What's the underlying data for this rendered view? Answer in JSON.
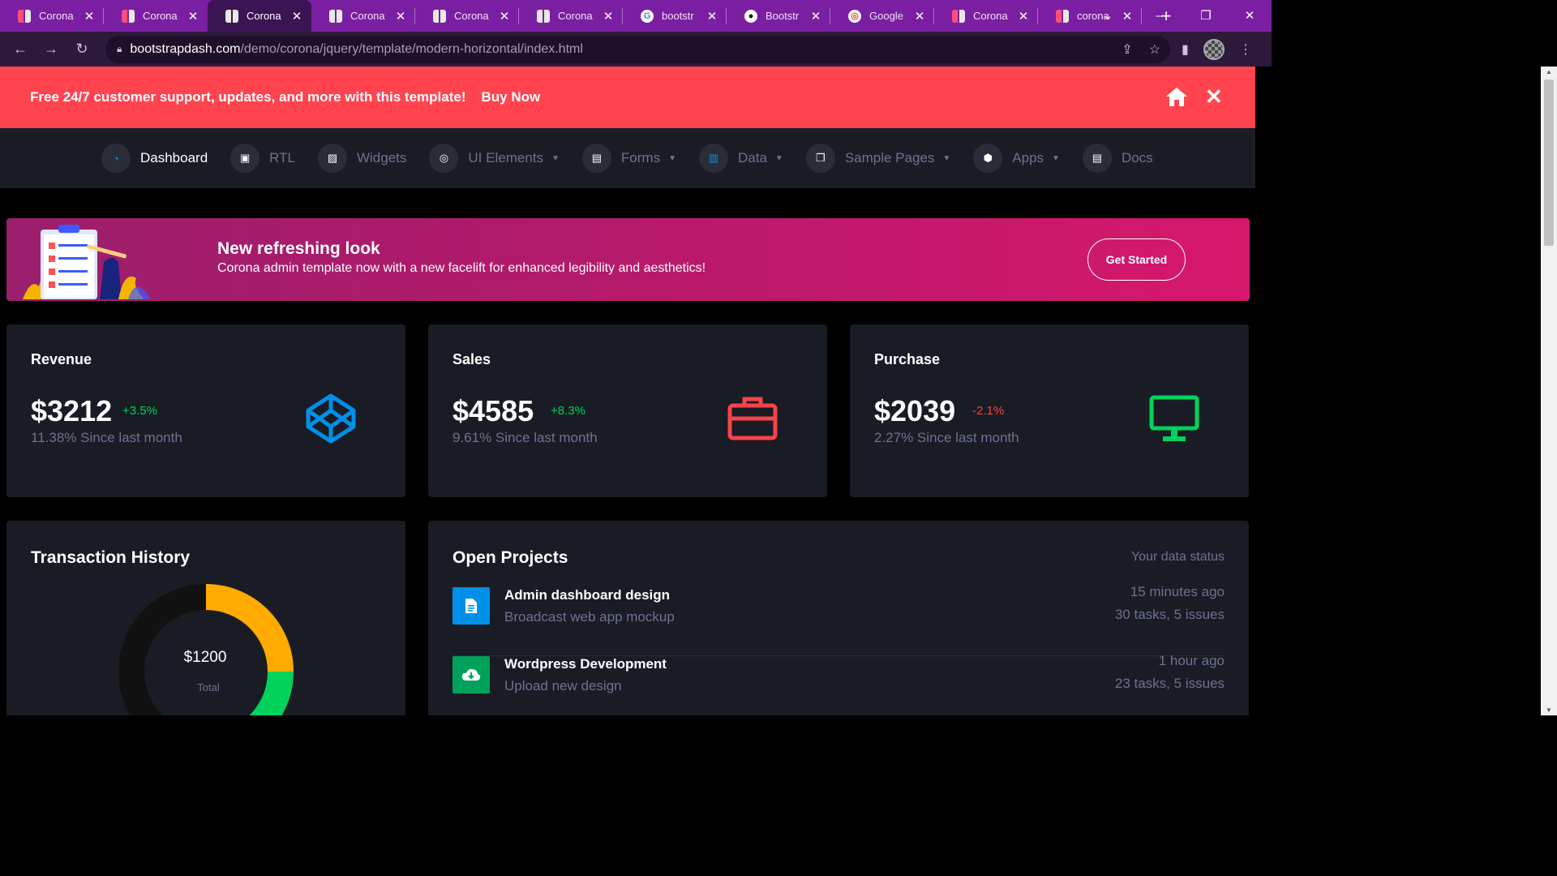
{
  "browser": {
    "tabs": [
      {
        "title": "Corona",
        "icon": "corona-favicon",
        "active": false
      },
      {
        "title": "Corona",
        "icon": "corona-favicon",
        "active": false
      },
      {
        "title": "Corona",
        "icon": "corona-favicon",
        "active": true
      },
      {
        "title": "Corona",
        "icon": "corona-favicon",
        "active": false
      },
      {
        "title": "Corona",
        "icon": "corona-favicon",
        "active": false
      },
      {
        "title": "Corona",
        "icon": "corona-favicon",
        "active": false
      },
      {
        "title": "bootstr",
        "icon": "google-icon",
        "active": false
      },
      {
        "title": "Bootstr",
        "icon": "github-icon",
        "active": false
      },
      {
        "title": "Google",
        "icon": "google-lens-icon",
        "active": false
      },
      {
        "title": "Corona",
        "icon": "corona-favicon",
        "active": false
      },
      {
        "title": "corona",
        "icon": "corona-favicon",
        "active": false
      }
    ],
    "url_host": "bootstrapdash.com",
    "url_path": "/demo/corona/jquery/template/modern-horizontal/index.html"
  },
  "promo": {
    "message": "Free 24/7 customer support, updates, and more with this template!",
    "buy_label": "Buy Now"
  },
  "nav": {
    "items": [
      {
        "label": "Dashboard",
        "icon": "speedometer-icon"
      },
      {
        "label": "RTL",
        "icon": "file-icon"
      },
      {
        "label": "Widgets",
        "icon": "texture-icon"
      },
      {
        "label": "UI Elements",
        "icon": "crosshair-icon"
      },
      {
        "label": "Forms",
        "icon": "clipboard-icon"
      },
      {
        "label": "Data",
        "icon": "chart-bar-icon"
      },
      {
        "label": "Sample Pages",
        "icon": "copy-icon"
      },
      {
        "label": "Apps",
        "icon": "hexagon-icon"
      },
      {
        "label": "Docs",
        "icon": "document-icon"
      }
    ]
  },
  "banner": {
    "heading": "New refreshing look",
    "subtext": "Corona admin template now with a new facelift for enhanced legibility and aesthetics!",
    "button": "Get Started"
  },
  "stats": [
    {
      "title": "Revenue",
      "amount": "$3212",
      "change": "+3.5%",
      "since": "11.38% Since last month",
      "icon": "codepen-icon",
      "color": "#0090e7"
    },
    {
      "title": "Sales",
      "amount": "$4585",
      "change": "+8.3%",
      "since": "9.61% Since last month",
      "icon": "briefcase-icon",
      "color": "#fc424a"
    },
    {
      "title": "Purchase",
      "amount": "$2039",
      "change": "-2.1%",
      "since": "2.27% Since last month",
      "icon": "monitor-icon",
      "color": "#00d25b"
    }
  ],
  "transaction": {
    "title": "Transaction History",
    "amount": "$1200",
    "label": "Total",
    "chart_data": {
      "type": "pie",
      "values": [
        0.25,
        0.2,
        0.55
      ],
      "colors": [
        "#ffab00",
        "#00d25b",
        "#111111"
      ]
    }
  },
  "projects": {
    "title": "Open Projects",
    "status": "Your data status",
    "items": [
      {
        "name": "Admin dashboard design",
        "desc": "Broadcast web app mockup",
        "time": "15 minutes ago",
        "tasks": "30 tasks, 5 issues",
        "icon": "file-document-icon"
      },
      {
        "name": "Wordpress Development",
        "desc": "Upload new design",
        "time": "1 hour ago",
        "tasks": "23 tasks, 5 issues",
        "icon": "cloud-download-icon"
      }
    ]
  }
}
